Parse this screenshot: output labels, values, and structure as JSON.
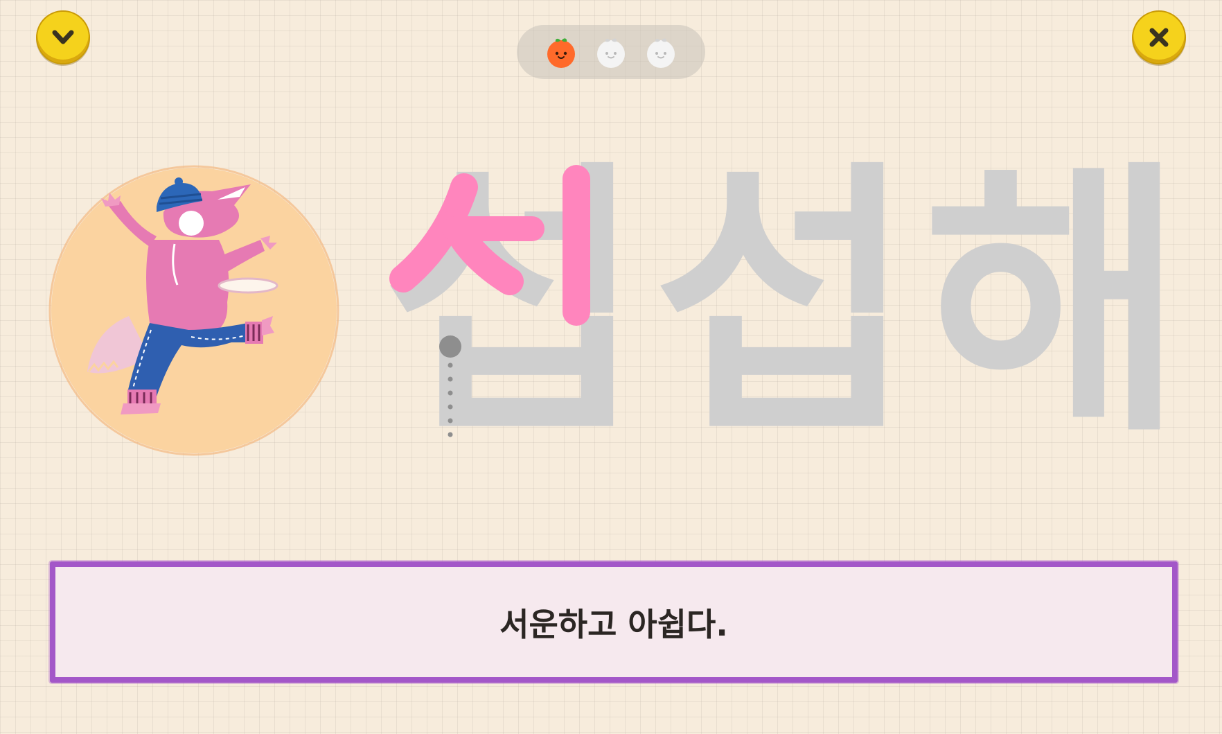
{
  "toolbar": {
    "collapse_icon": "chevron-down-icon",
    "close_icon": "close-icon",
    "button_color": "#f5d21c"
  },
  "progress": {
    "total": 3,
    "completed": 1,
    "items": [
      {
        "icon": "tangerine-icon",
        "state": "completed",
        "color": "#ff6a2a"
      },
      {
        "icon": "tangerine-icon",
        "state": "pending",
        "color": "#f4f4f4"
      },
      {
        "icon": "tangerine-icon",
        "state": "pending",
        "color": "#f4f4f4"
      }
    ]
  },
  "illustration": {
    "icon": "dinosaur-frisbee-illustration"
  },
  "word": {
    "characters": [
      "섭",
      "섭",
      "해"
    ],
    "trace_color": "#ff85bd",
    "guide_color": "#cfcfcf",
    "traced_strokes": 2
  },
  "sentence": {
    "text": "서운하고 아쉽다.",
    "border_color": "#a357c8"
  }
}
